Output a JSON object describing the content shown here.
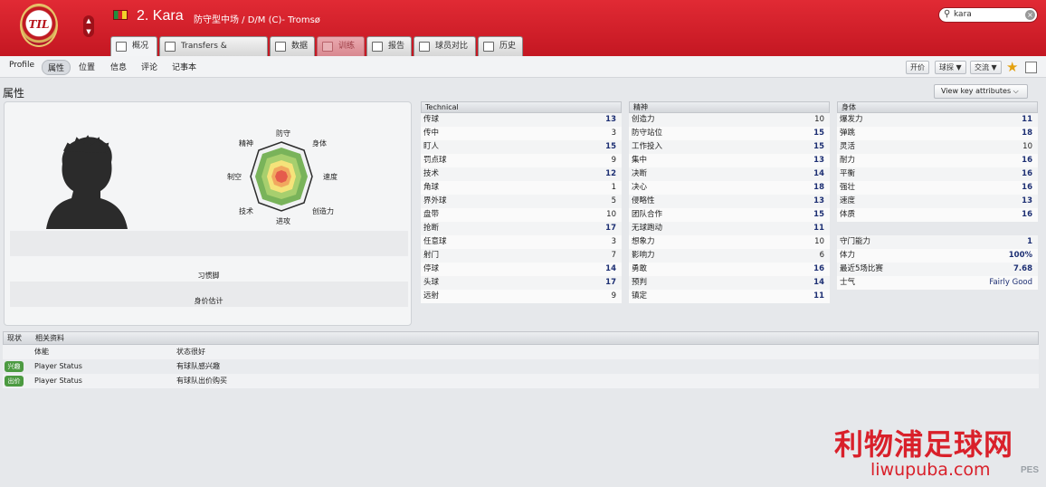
{
  "header": {
    "crest_text": "TIL",
    "nav_up": "▲",
    "nav_down": "▼",
    "player_name": "2. Kara",
    "player_sub": "防守型中场 / D/M (C)- Tromsø",
    "search_icon": "⚲",
    "search_value": "kara",
    "search_clear": "×",
    "tabs": [
      {
        "label": "概况"
      },
      {
        "label": "Transfers & Contracts"
      },
      {
        "label": "数据"
      },
      {
        "label": "训练"
      },
      {
        "label": "报告"
      },
      {
        "label": "球员对比"
      },
      {
        "label": "历史"
      }
    ]
  },
  "subnav": {
    "items": [
      "Profile",
      "属性",
      "位置",
      "信息",
      "评论",
      "记事本"
    ],
    "right_buttons": [
      "开价",
      "球探 ▼",
      "交流 ▼"
    ],
    "star_icon": "★"
  },
  "section": {
    "title": "属性",
    "view_key": "View key attributes ⌵"
  },
  "radar": {
    "labels": [
      "防守",
      "身体",
      "速度",
      "创造力",
      "进攻",
      "技术",
      "制空",
      "精神"
    ]
  },
  "profile": {
    "foot_label": "习惯脚",
    "value_label": "身价估计"
  },
  "technical": {
    "header": "Technical",
    "rows": [
      {
        "name": "传球",
        "value": "13"
      },
      {
        "name": "传中",
        "value": "3"
      },
      {
        "name": "盯人",
        "value": "15"
      },
      {
        "name": "罚点球",
        "value": "9"
      },
      {
        "name": "技术",
        "value": "12"
      },
      {
        "name": "角球",
        "value": "1"
      },
      {
        "name": "界外球",
        "value": "5"
      },
      {
        "name": "盘带",
        "value": "10"
      },
      {
        "name": "抢断",
        "value": "17"
      },
      {
        "name": "任意球",
        "value": "3"
      },
      {
        "name": "射门",
        "value": "7"
      },
      {
        "name": "停球",
        "value": "14"
      },
      {
        "name": "头球",
        "value": "17"
      },
      {
        "name": "远射",
        "value": "9"
      }
    ]
  },
  "mental": {
    "header": "精神",
    "rows": [
      {
        "name": "创造力",
        "value": "10"
      },
      {
        "name": "防守站位",
        "value": "15"
      },
      {
        "name": "工作投入",
        "value": "15"
      },
      {
        "name": "集中",
        "value": "13"
      },
      {
        "name": "决断",
        "value": "14"
      },
      {
        "name": "决心",
        "value": "18"
      },
      {
        "name": "侵略性",
        "value": "13"
      },
      {
        "name": "团队合作",
        "value": "15"
      },
      {
        "name": "无球跑动",
        "value": "11"
      },
      {
        "name": "想象力",
        "value": "10"
      },
      {
        "name": "影响力",
        "value": "6"
      },
      {
        "name": "勇敢",
        "value": "16"
      },
      {
        "name": "预判",
        "value": "14"
      },
      {
        "name": "镇定",
        "value": "11"
      }
    ]
  },
  "physical": {
    "header": "身体",
    "rows": [
      {
        "name": "爆发力",
        "value": "11"
      },
      {
        "name": "弹跳",
        "value": "18"
      },
      {
        "name": "灵活",
        "value": "10"
      },
      {
        "name": "耐力",
        "value": "16"
      },
      {
        "name": "平衡",
        "value": "16"
      },
      {
        "name": "强壮",
        "value": "16"
      },
      {
        "name": "速度",
        "value": "13"
      },
      {
        "name": "体质",
        "value": "16"
      }
    ],
    "extra": [
      {
        "name": "守门能力",
        "value": "1"
      },
      {
        "name": "体力",
        "value": "100%"
      },
      {
        "name": "最近5场比赛",
        "value": "7.68"
      },
      {
        "name": "士气",
        "value": "Fairly Good"
      }
    ]
  },
  "status": {
    "header_col1": "现状",
    "header_col2": "相关资料",
    "rows": [
      {
        "badge": "",
        "col2": "体能",
        "col3": "状态很好"
      },
      {
        "badge": "兴趣",
        "col2": "Player Status",
        "col3": "有球队感兴趣"
      },
      {
        "badge": "出价",
        "col2": "Player Status",
        "col3": "有球队出价购买"
      }
    ]
  },
  "watermark": {
    "title": "利物浦足球网",
    "url": "liwupuba.com",
    "corner": "PES"
  },
  "colors": {
    "header_red": "#d21f29",
    "value_blue": "#1d2f73",
    "badge_green": "#4c9a41"
  }
}
